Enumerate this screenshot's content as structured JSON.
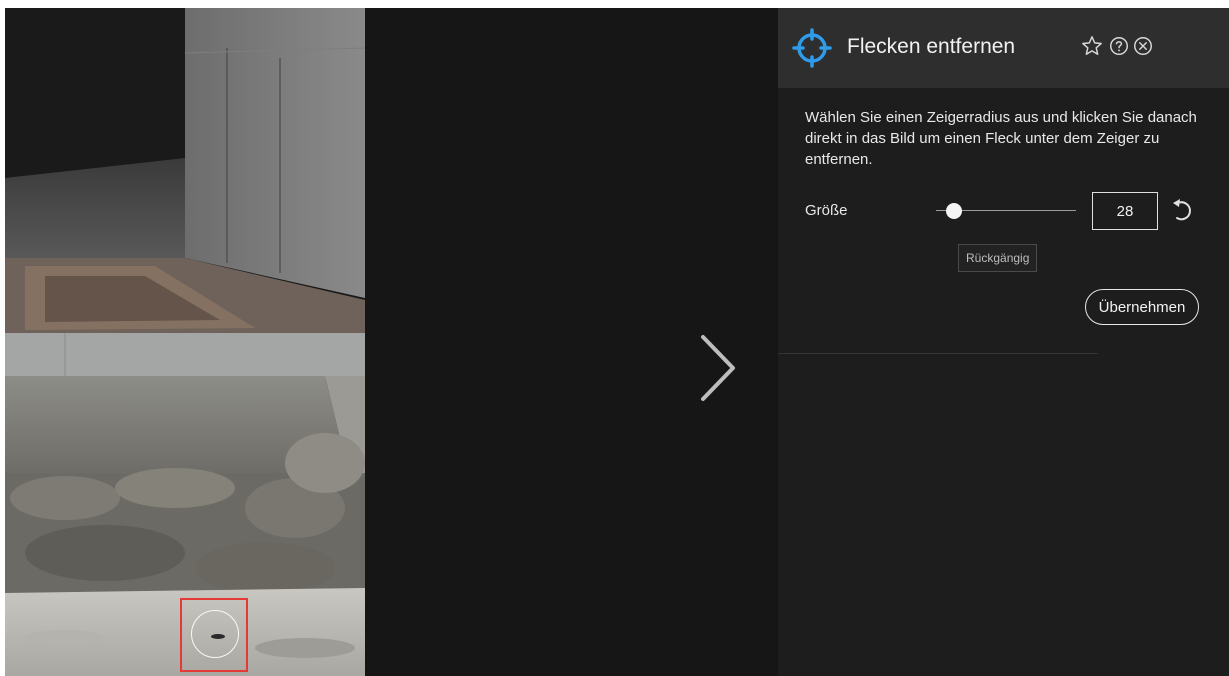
{
  "photo": {
    "description_icon": "photo-canvas"
  },
  "navigation": {
    "next_icon": "chevron-right-icon"
  },
  "panel": {
    "title": "Flecken entfernen",
    "title_icon": "crosshair-target-icon",
    "header_buttons": [
      "star-icon",
      "help-icon",
      "close-icon"
    ],
    "description": "Wählen Sie einen Zeigerradius aus und klicken Sie danach direkt in das Bild um einen Fleck unter dem Zeiger zu entfernen.",
    "size_label": "Größe",
    "size_value": "28",
    "size_fraction": 0.13,
    "reset_icon": "undo-icon",
    "tooltip": "Rückgängig",
    "apply_label": "Übernehmen"
  },
  "colors": {
    "accent": "#2f9bea",
    "marker": "#e53935",
    "background": "#161616",
    "panel": "#1d1d1d",
    "header": "#2e2e2e"
  }
}
